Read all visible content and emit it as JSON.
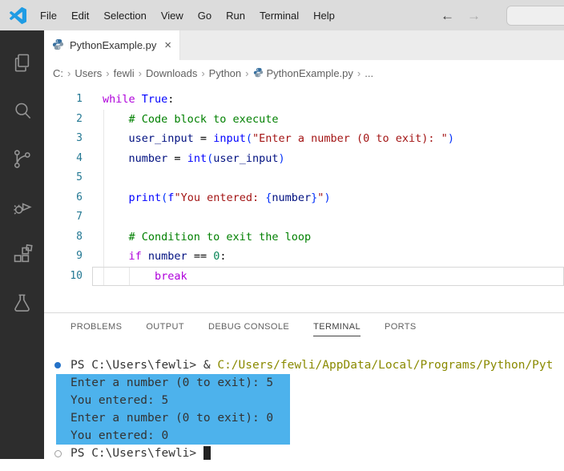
{
  "colors": {
    "keyword": "#af00db",
    "builtin": "#0000ff",
    "variable": "#001080",
    "string": "#a31515",
    "number": "#098658",
    "comment": "#008000",
    "plain": "#000000",
    "paren": "#0431fa",
    "line_number": "#237893",
    "terminal_fg": "#333333",
    "terminal_cmd": "#8a8a00",
    "selection": "#4db2ec",
    "decoration_filled": "#2472c8",
    "decoration_open": "#9e9e9e",
    "logo_blue": "#1f9ce4",
    "python_blue": "#366f9f",
    "python_gray": "#8498a8"
  },
  "titlebar": {
    "menus": [
      "File",
      "Edit",
      "Selection",
      "View",
      "Go",
      "Run",
      "Terminal",
      "Help"
    ],
    "back_glyph": "←",
    "forward_glyph": "→",
    "search_value": ""
  },
  "activitybar": {
    "icons": [
      "explorer-icon",
      "search-icon",
      "source-control-icon",
      "run-debug-icon",
      "extensions-icon",
      "testing-icon"
    ]
  },
  "editor_tab": {
    "label": "PythonExample.py",
    "close_glyph": "×"
  },
  "breadcrumb": {
    "separator": "›",
    "segments": [
      {
        "label": "C:"
      },
      {
        "label": "Users"
      },
      {
        "label": "fewli"
      },
      {
        "label": "Downloads"
      },
      {
        "label": "Python"
      },
      {
        "label": "PythonExample.py",
        "icon": "python-icon"
      },
      {
        "label": "..."
      }
    ]
  },
  "code": {
    "lines": [
      {
        "num": "1",
        "tokens": [
          {
            "t": "while",
            "c": "keyword"
          },
          {
            "t": " ",
            "c": "plain"
          },
          {
            "t": "True",
            "c": "builtin"
          },
          {
            "t": ":",
            "c": "plain"
          }
        ]
      },
      {
        "num": "2",
        "tokens": [
          {
            "t": "    ",
            "c": "plain"
          },
          {
            "t": "# Code block to execute",
            "c": "comment"
          }
        ]
      },
      {
        "num": "3",
        "tokens": [
          {
            "t": "    ",
            "c": "plain"
          },
          {
            "t": "user_input",
            "c": "variable"
          },
          {
            "t": " = ",
            "c": "plain"
          },
          {
            "t": "input",
            "c": "builtin"
          },
          {
            "t": "(",
            "c": "paren"
          },
          {
            "t": "\"Enter a number (0 to exit): \"",
            "c": "string"
          },
          {
            "t": ")",
            "c": "paren"
          }
        ]
      },
      {
        "num": "4",
        "tokens": [
          {
            "t": "    ",
            "c": "plain"
          },
          {
            "t": "number",
            "c": "variable"
          },
          {
            "t": " = ",
            "c": "plain"
          },
          {
            "t": "int",
            "c": "builtin"
          },
          {
            "t": "(",
            "c": "paren"
          },
          {
            "t": "user_input",
            "c": "variable"
          },
          {
            "t": ")",
            "c": "paren"
          }
        ]
      },
      {
        "num": "5",
        "tokens": []
      },
      {
        "num": "6",
        "tokens": [
          {
            "t": "    ",
            "c": "plain"
          },
          {
            "t": "print",
            "c": "builtin"
          },
          {
            "t": "(",
            "c": "paren"
          },
          {
            "t": "f",
            "c": "builtin"
          },
          {
            "t": "\"You entered: ",
            "c": "string"
          },
          {
            "t": "{",
            "c": "paren"
          },
          {
            "t": "number",
            "c": "variable"
          },
          {
            "t": "}",
            "c": "paren"
          },
          {
            "t": "\"",
            "c": "string"
          },
          {
            "t": ")",
            "c": "paren"
          }
        ]
      },
      {
        "num": "7",
        "tokens": []
      },
      {
        "num": "8",
        "tokens": [
          {
            "t": "    ",
            "c": "plain"
          },
          {
            "t": "# Condition to exit the loop",
            "c": "comment"
          }
        ]
      },
      {
        "num": "9",
        "tokens": [
          {
            "t": "    ",
            "c": "plain"
          },
          {
            "t": "if",
            "c": "keyword"
          },
          {
            "t": " ",
            "c": "plain"
          },
          {
            "t": "number",
            "c": "variable"
          },
          {
            "t": " == ",
            "c": "plain"
          },
          {
            "t": "0",
            "c": "number"
          },
          {
            "t": ":",
            "c": "plain"
          }
        ]
      },
      {
        "num": "10",
        "tokens": [
          {
            "t": "        ",
            "c": "plain"
          },
          {
            "t": "break",
            "c": "keyword"
          }
        ],
        "current": true
      }
    ]
  },
  "panel": {
    "tabs": [
      {
        "label": "PROBLEMS"
      },
      {
        "label": "OUTPUT"
      },
      {
        "label": "DEBUG CONSOLE"
      },
      {
        "label": "TERMINAL",
        "active": true
      },
      {
        "label": "PORTS"
      }
    ]
  },
  "terminal": {
    "lines": [
      {
        "decoration": "filled",
        "tokens": [
          {
            "t": "PS C:\\Users\\fewli> ",
            "c": "terminal_fg"
          },
          {
            "t": "& ",
            "c": "terminal_fg"
          },
          {
            "t": "C:/Users/fewli/AppData/Local/Programs/Python/Pyt",
            "c": "terminal_cmd"
          }
        ]
      },
      {
        "selected": true,
        "tokens": [
          {
            "t": "Enter a number (0 to exit): 5",
            "c": "terminal_fg"
          }
        ]
      },
      {
        "selected": true,
        "tokens": [
          {
            "t": "You entered: 5",
            "c": "terminal_fg"
          }
        ]
      },
      {
        "selected": true,
        "tokens": [
          {
            "t": "Enter a number (0 to exit): 0",
            "c": "terminal_fg"
          }
        ]
      },
      {
        "selected": true,
        "tokens": [
          {
            "t": "You entered: 0",
            "c": "terminal_fg"
          }
        ]
      },
      {
        "decoration": "open",
        "cursor": true,
        "tokens": [
          {
            "t": "PS C:\\Users\\fewli> ",
            "c": "terminal_fg"
          }
        ]
      }
    ]
  }
}
